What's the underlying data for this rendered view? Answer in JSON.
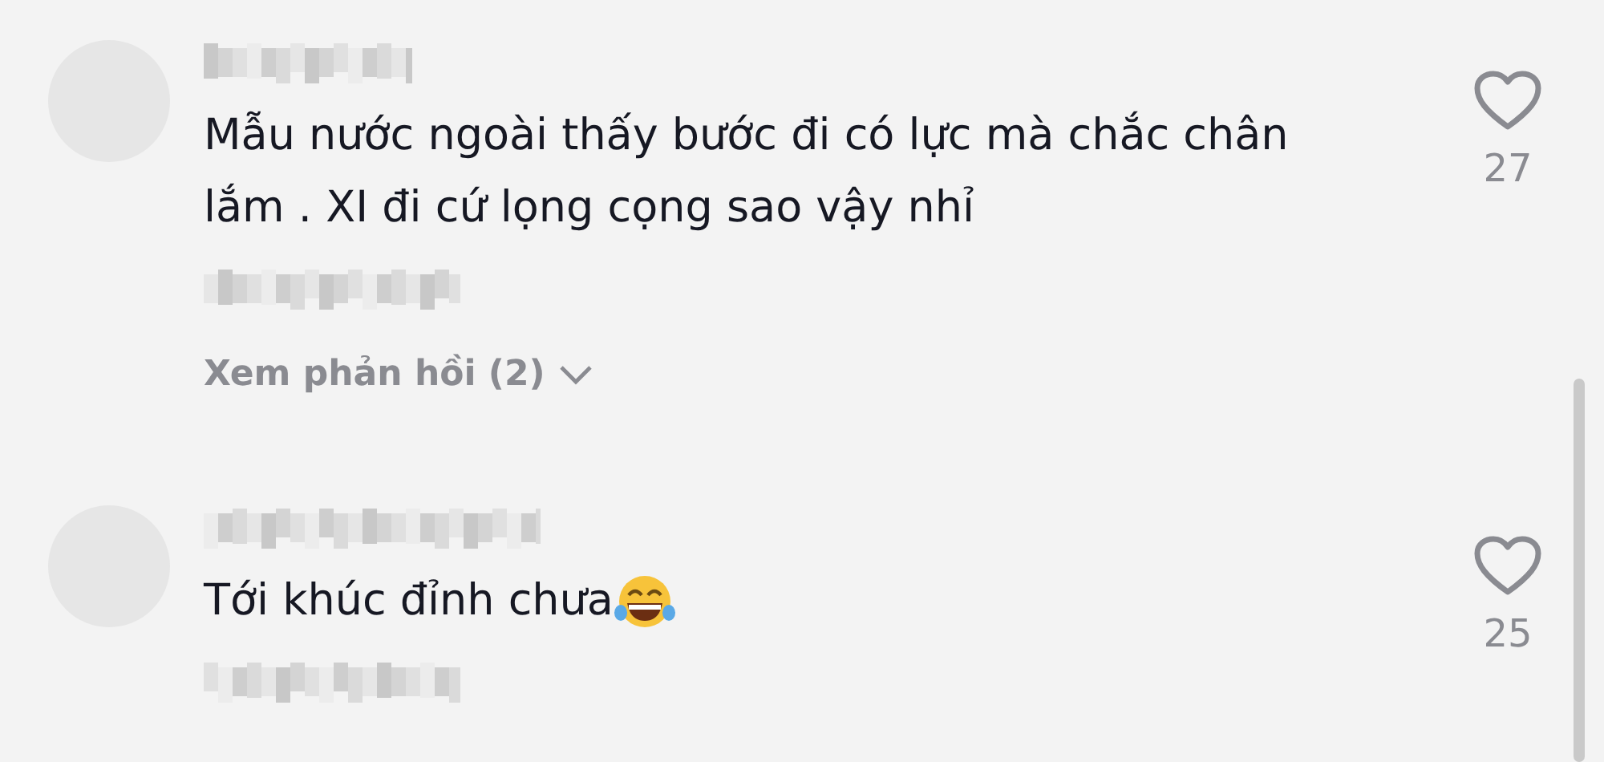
{
  "comments": [
    {
      "text": "Mẫu nước ngoài thấy bước đi có lực mà chắc chân lắm . XI đi cứ lọng cọng sao vậy nhỉ",
      "emoji": false,
      "likes": "27",
      "liked": false,
      "replies_link": "Xem phản hồi (2)"
    },
    {
      "text": "Tới khúc đỉnh chưa",
      "emoji": true,
      "likes": "25",
      "liked": false
    }
  ]
}
